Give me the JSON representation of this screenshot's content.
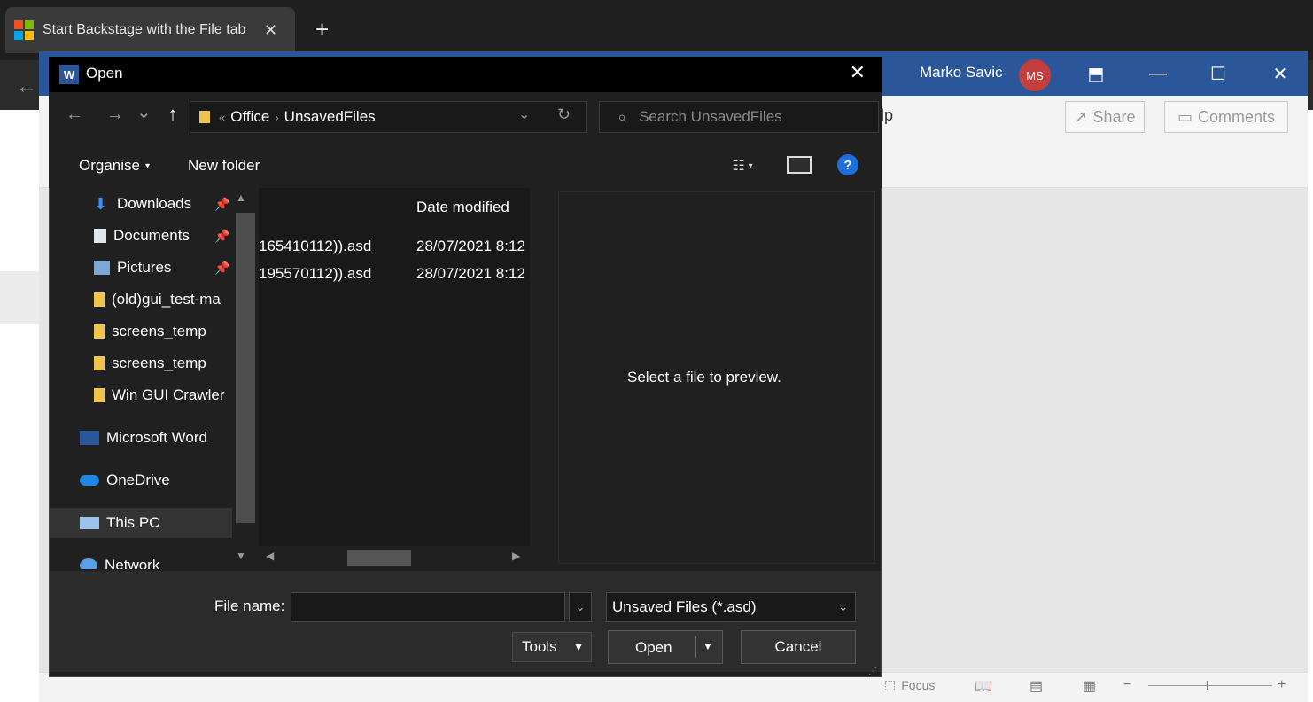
{
  "browser": {
    "tab_title": "Start Backstage with the File tab",
    "tab_close": "✕",
    "new_tab": "+",
    "back": "←"
  },
  "word": {
    "user_name": "Marko Savic",
    "user_initials": "MS",
    "window_buttons": {
      "ribbon_display": "⬒",
      "minimize": "—",
      "maximize": "☐",
      "close": "✕"
    },
    "help_tab": "lp",
    "share": "Share",
    "comments": "Comments",
    "status": {
      "focus": "Focus"
    }
  },
  "dialog": {
    "title": "Open",
    "close": "✕",
    "nav": {
      "back": "←",
      "forward": "→",
      "recent": "⌄",
      "up": "↑"
    },
    "address": {
      "overflow": "«",
      "crumbs": [
        "Office",
        "UnsavedFiles"
      ],
      "sep": "›",
      "dropdown": "⌄",
      "refresh": "↻"
    },
    "search_placeholder": "Search UnsavedFiles",
    "toolbar": {
      "organise": "Organise",
      "new_folder": "New folder",
      "help": "?"
    },
    "nav_items": [
      {
        "label": "Downloads",
        "icon": "download-icon",
        "pinned": true
      },
      {
        "label": "Documents",
        "icon": "document-icon",
        "pinned": true
      },
      {
        "label": "Pictures",
        "icon": "pictures-icon",
        "pinned": true
      },
      {
        "label": "(old)gui_test-ma",
        "icon": "folder-icon",
        "pinned": false
      },
      {
        "label": "screens_temp",
        "icon": "folder-icon",
        "pinned": false
      },
      {
        "label": "screens_temp",
        "icon": "folder-icon",
        "pinned": false
      },
      {
        "label": "Win GUI Crawler",
        "icon": "folder-icon",
        "pinned": false
      },
      {
        "label": "Microsoft Word",
        "icon": "word-icon",
        "pinned": false
      },
      {
        "label": "OneDrive",
        "icon": "onedrive-icon",
        "pinned": false
      },
      {
        "label": "This PC",
        "icon": "computer-icon",
        "pinned": false
      },
      {
        "label": "Network",
        "icon": "network-icon",
        "pinned": false
      }
    ],
    "columns": {
      "date_modified": "Date modified"
    },
    "files": [
      {
        "name": "165410112)).asd",
        "date": "28/07/2021 8:12"
      },
      {
        "name": "195570112)).asd",
        "date": "28/07/2021 8:12"
      }
    ],
    "preview_text": "Select a file to preview.",
    "file_name_label": "File name:",
    "file_name_value": "",
    "file_type": "Unsaved Files (*.asd)",
    "tools": "Tools",
    "open": "Open",
    "cancel": "Cancel"
  },
  "colors": {
    "word_blue": "#2b579a",
    "dialog_bg": "#202020",
    "avatar_red": "#c43e3e",
    "help_blue": "#1e6fd9"
  }
}
